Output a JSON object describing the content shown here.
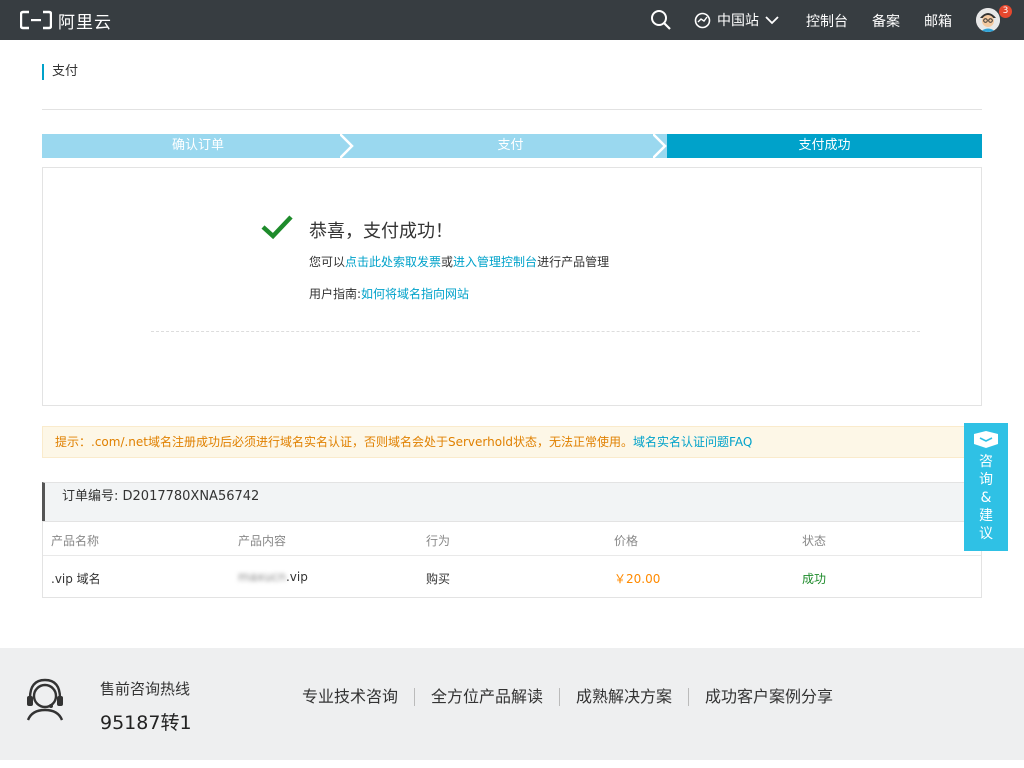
{
  "nav": {
    "logo_text": "阿里云",
    "region": "中国站",
    "links": [
      "控制台",
      "备案",
      "邮箱"
    ],
    "badge_count": "3"
  },
  "page": {
    "title": "支付"
  },
  "steps": [
    {
      "label": "确认订单"
    },
    {
      "label": "支付"
    },
    {
      "label": "支付成功"
    }
  ],
  "success": {
    "title": "恭喜，支付成功！",
    "line1_prefix": "您可以",
    "invoice_link": "点击此处索取发票",
    "line1_mid": "或",
    "console_link": "进入管理控制台",
    "line1_suffix": "进行产品管理",
    "guide_label": "用户指南:",
    "guide_link": "如何将域名指向网站"
  },
  "tip": {
    "text": "提示：.com/.net域名注册成功后必须进行域名实名认证，否则域名会处于Serverhold状态，无法正常使用。",
    "faq_link": "域名实名认证问题FAQ"
  },
  "order": {
    "number_label": "订单编号: D2017780XNA56742",
    "headers": [
      "产品名称",
      "产品内容",
      "行为",
      "价格",
      "状态"
    ],
    "row": {
      "name": ".vip 域名",
      "content_hidden": "maxucn",
      "content_suffix": ".vip",
      "action": "购买",
      "price": "￥20.00",
      "status": "成功"
    }
  },
  "consult": {
    "label_lines": [
      "咨",
      "询",
      "&",
      "建",
      "议"
    ]
  },
  "footer": {
    "hotline_label": "售前咨询热线",
    "hotline_number": "95187转1",
    "links": [
      "专业技术咨询",
      "全方位产品解读",
      "成熟解决方案",
      "成功客户案例分享"
    ]
  },
  "colors": {
    "nav_bg": "#373d41",
    "accent": "#00a2ca",
    "step_done": "#9ad8ef",
    "tip_text": "#e08000",
    "price": "#ff8a00",
    "success_green": "#1e8b2b",
    "consult_bg": "#2fc1e5"
  },
  "icons": [
    "aliyun-logo-icon",
    "search-icon",
    "globe-icon",
    "chevron-down-icon",
    "avatar",
    "check-icon",
    "chat-icon",
    "headset-icon"
  ]
}
